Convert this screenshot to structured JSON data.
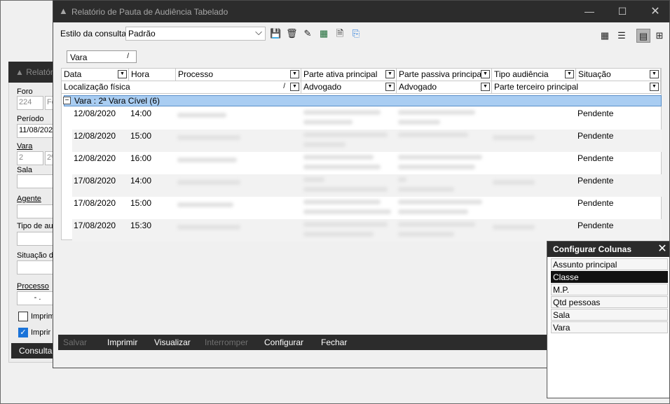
{
  "background_window": {
    "title": "Relatór",
    "labels": {
      "foro": "Foro",
      "periodo": "Período",
      "vara": "Vara",
      "sala": "Sala",
      "agente": "Agente",
      "tipo": "Tipo de au",
      "situacao": "Situação d",
      "processo": "Processo",
      "imprimir1": "Imprimi",
      "imprimir2": "Imprir"
    },
    "values": {
      "foro_code": "224",
      "foro_name": "Fo",
      "periodo": "11/08/202",
      "vara_code": "2",
      "vara_name": "2ª",
      "processo": "- ."
    },
    "consultar": "Consultar"
  },
  "window": {
    "title": "Relatório de Pauta de Audiência Tabelado",
    "minimize": "—",
    "maximize": "☐",
    "close": "✕"
  },
  "toolbar": {
    "style_label": "Estilo da consulta",
    "style_value": "Padrão"
  },
  "group_chip": {
    "label": "Vara",
    "sort": "/"
  },
  "grid": {
    "columns_row1": [
      "Data",
      "Hora",
      "Processo",
      "Parte ativa principal",
      "Parte passiva principal",
      "Tipo audiência",
      "Situação"
    ],
    "columns_row2": [
      "Localização física",
      "Advogado",
      "Advogado",
      "Parte terceiro principal"
    ],
    "loc_sort": "/",
    "group_toggle": "−",
    "group_label": "Vara : 2ª Vara Cível (6)",
    "rows": [
      {
        "data": "12/08/2020",
        "hora": "14:00",
        "situacao": "Pendente"
      },
      {
        "data": "12/08/2020",
        "hora": "15:00",
        "situacao": "Pendente"
      },
      {
        "data": "12/08/2020",
        "hora": "16:00",
        "situacao": "Pendente"
      },
      {
        "data": "17/08/2020",
        "hora": "14:00",
        "situacao": "Pendente"
      },
      {
        "data": "17/08/2020",
        "hora": "15:00",
        "situacao": "Pendente"
      },
      {
        "data": "17/08/2020",
        "hora": "15:30",
        "situacao": "Pendente"
      }
    ]
  },
  "buttons": {
    "salvar": "Salvar",
    "imprimir": "Imprimir",
    "visualizar": "Visualizar",
    "interromper": "Interromper",
    "configurar": "Configurar",
    "fechar": "Fechar"
  },
  "config_panel": {
    "title": "Configurar Colunas",
    "close": "✕",
    "items": [
      "Assunto principal",
      "Classe",
      "M.P.",
      "Qtd pessoas",
      "Sala",
      "Vara"
    ],
    "selected": "Classe"
  },
  "colors": {
    "accent": "#1a73d9",
    "group_row": "#a9cdf2",
    "titlebar": "#2c2c2c"
  }
}
